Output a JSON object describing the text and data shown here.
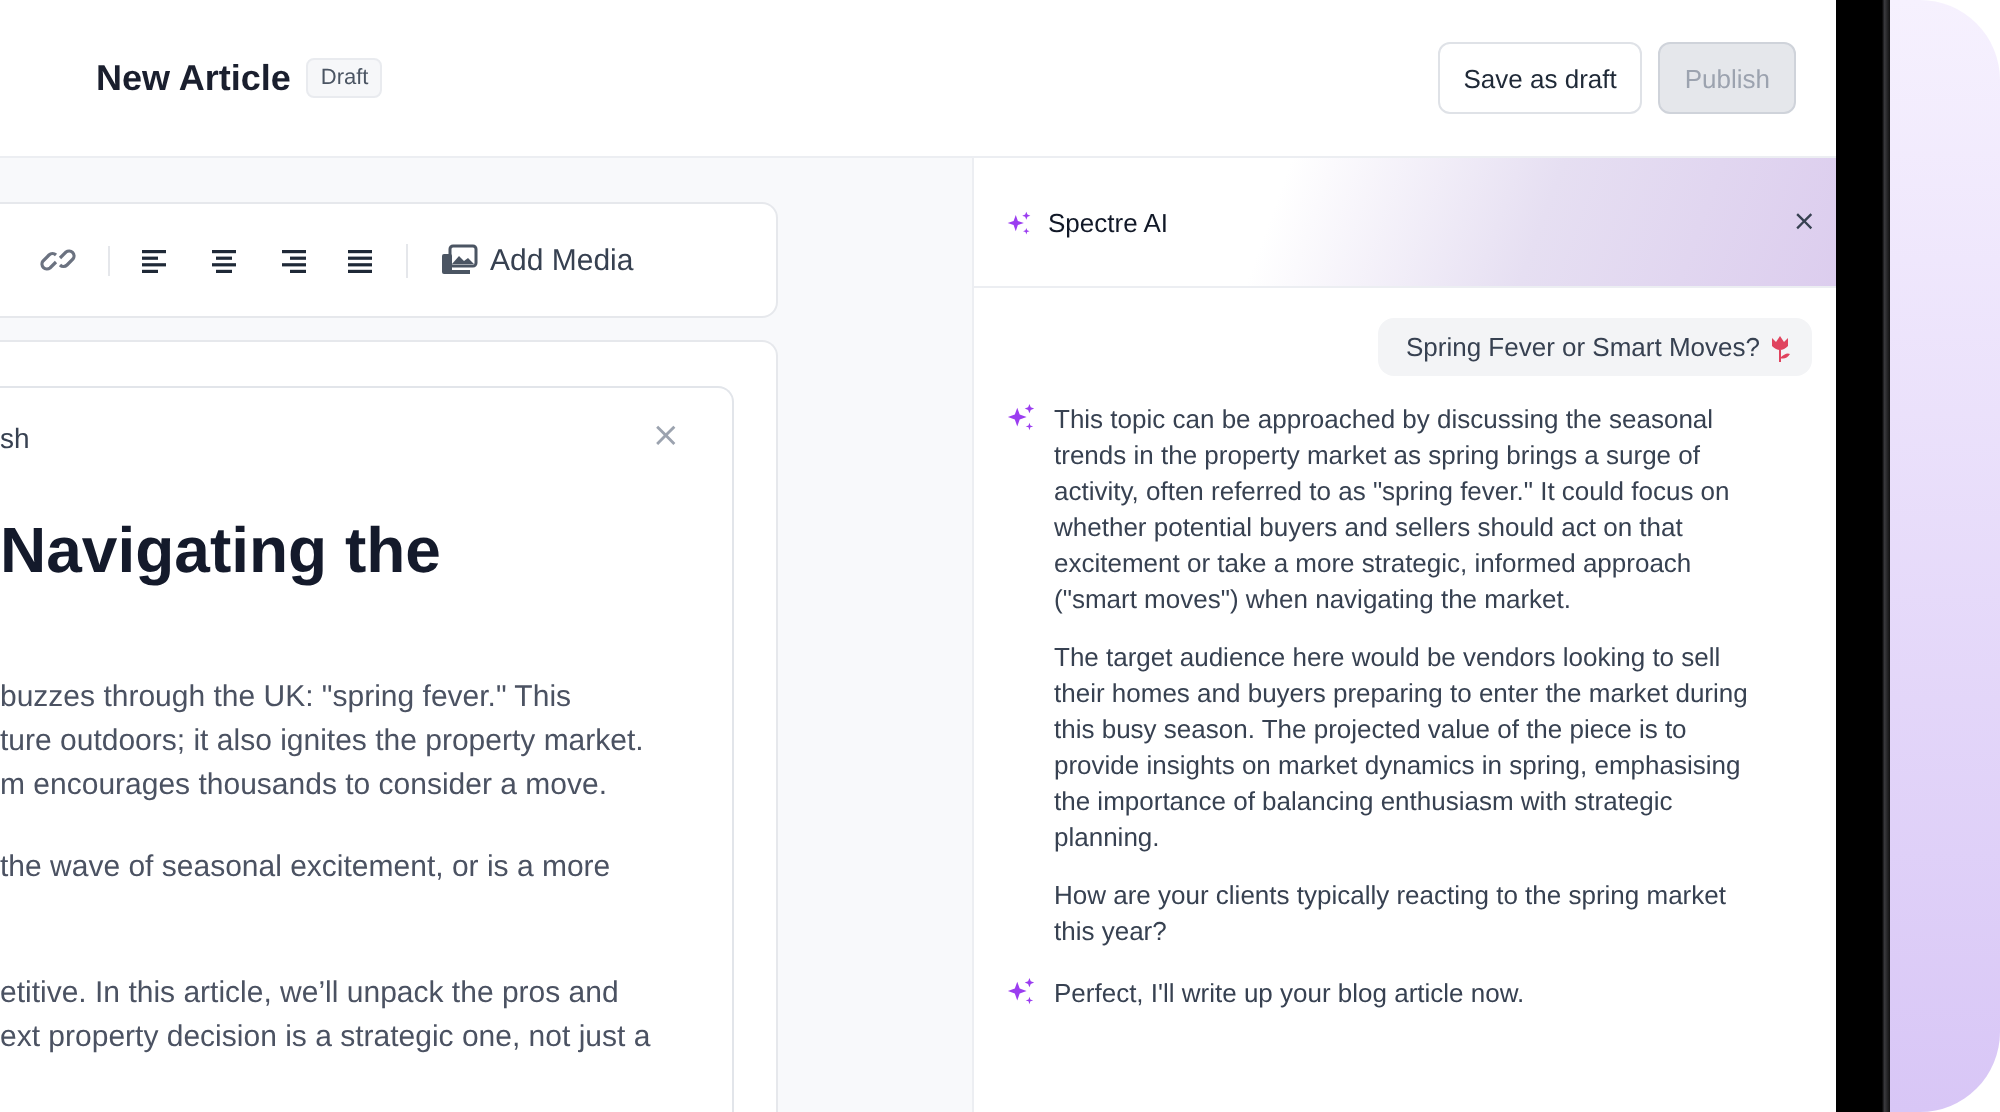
{
  "header": {
    "title": "New Article",
    "status_badge": "Draft",
    "buttons": [
      {
        "label": "Save as draft",
        "disabled": false
      },
      {
        "label": "Publish",
        "disabled": true
      }
    ]
  },
  "toolbar": {
    "groups": [
      [
        {
          "kind": "link"
        }
      ],
      [
        {
          "kind": "left"
        },
        {
          "kind": "center"
        },
        {
          "kind": "right"
        },
        {
          "kind": "justify"
        }
      ],
      [
        {
          "kind": "media",
          "label": "Add Media"
        }
      ]
    ]
  },
  "editor": {
    "tab_label": "sh",
    "close_glyph": "×",
    "heading": "Navigating the",
    "paragraphs": [
      [
        "buzzes through the UK: \"spring fever.\" This",
        "ture outdoors; it also ignites the property market.",
        "m encourages thousands to consider a move."
      ],
      [
        "the wave of seasonal excitement, or is a more"
      ],
      [
        "etitive. In this article, we’ll unpack the pros and",
        "ext property decision is a strategic one, not just a"
      ]
    ]
  },
  "chat": {
    "title": "Spectre AI",
    "close_glyph": "×",
    "messages": [
      {
        "kind": "user",
        "text": "Spring Fever or Smart Moves?"
      },
      {
        "kind": "assistant",
        "paragraphs": [
          "This topic can be approached by discussing the seasonal trends in the property market as spring brings a surge of activity, often referred to as \"spring fever.\" It could focus on whether potential buyers and sellers should act on that excitement or take a more strategic, informed approach (\"smart moves\") when navigating the market.",
          "The target audience here would be vendors looking to sell their homes and buyers preparing to enter the market during this busy season. The projected value of the piece is to provide insights on market dynamics in spring, emphasising the importance of balancing enthusiasm with strategic planning.",
          "How are your clients typically reacting to the spring market this year?"
        ]
      },
      {
        "kind": "assistant",
        "paragraphs": [
          "Perfect, I'll write up your blog article now."
        ]
      }
    ]
  }
}
